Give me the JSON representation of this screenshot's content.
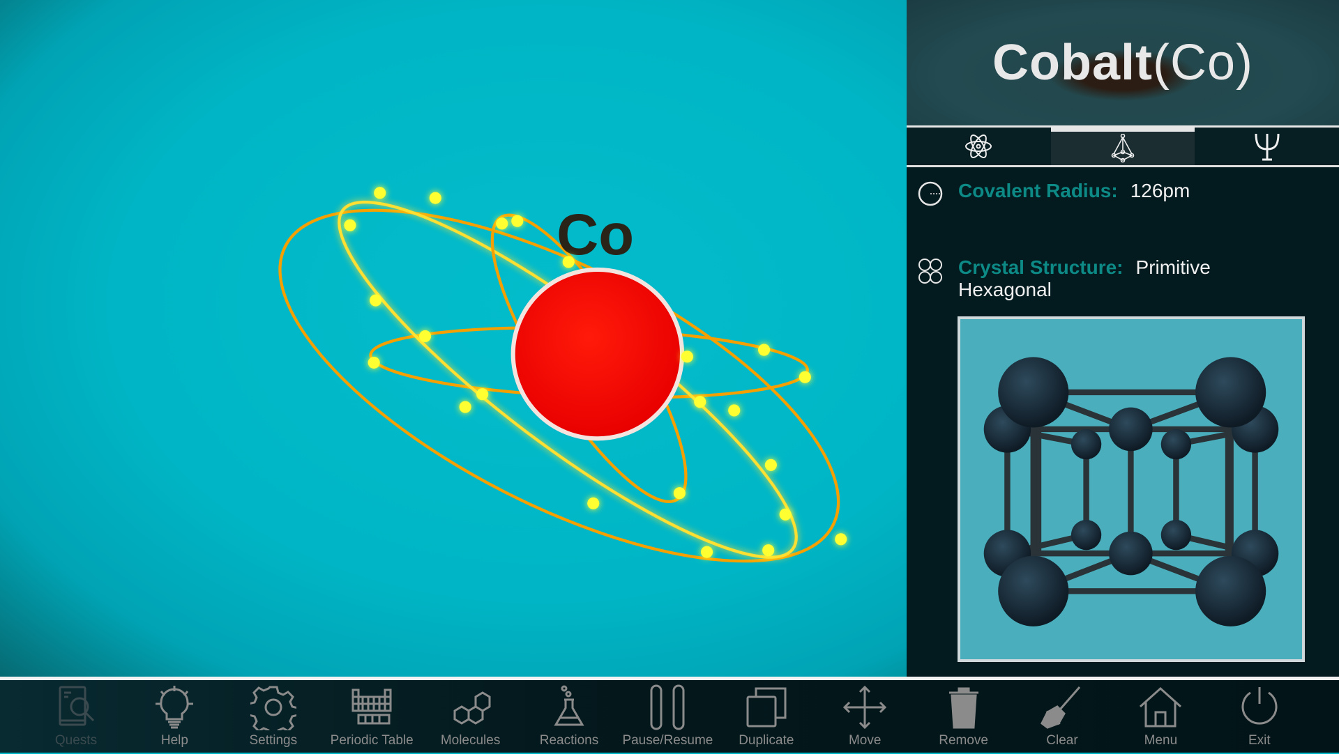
{
  "element": {
    "name": "Cobalt",
    "symbol": "Co",
    "title_symbol": "(Co)",
    "nucleus_color": "#ff0000",
    "orbit_color": "#f5a000",
    "electron_color": "#ffff20"
  },
  "panel": {
    "tabs": [
      {
        "icon": "atom-icon",
        "active": false
      },
      {
        "icon": "crystal-lattice-icon",
        "active": true
      },
      {
        "icon": "psi-icon",
        "active": false
      }
    ],
    "properties": [
      {
        "icon": "radius-circle-icon",
        "label": "Covalent Radius:",
        "value": "126pm"
      },
      {
        "icon": "crystal-structure-icon",
        "label": "Crystal Structure:",
        "value": "Primitive",
        "value_line2": "Hexagonal"
      }
    ]
  },
  "toolbar": {
    "items": [
      {
        "label": "Quests",
        "icon": "quests-book-search-icon",
        "enabled": false
      },
      {
        "label": "Help",
        "icon": "lightbulb-icon",
        "enabled": true
      },
      {
        "label": "Settings",
        "icon": "gear-icon",
        "enabled": true
      },
      {
        "label": "Periodic Table",
        "icon": "periodic-table-icon",
        "enabled": true
      },
      {
        "label": "Molecules",
        "icon": "molecule-icon",
        "enabled": true
      },
      {
        "label": "Reactions",
        "icon": "flask-icon",
        "enabled": true
      },
      {
        "label": "Pause/Resume",
        "icon": "pause-icon",
        "enabled": true
      },
      {
        "label": "Duplicate",
        "icon": "duplicate-icon",
        "enabled": true
      },
      {
        "label": "Move",
        "icon": "move-arrows-icon",
        "enabled": true
      },
      {
        "label": "Remove",
        "icon": "trash-icon",
        "enabled": true
      },
      {
        "label": "Clear",
        "icon": "broom-icon",
        "enabled": true
      },
      {
        "label": "Menu",
        "icon": "home-icon",
        "enabled": true
      },
      {
        "label": "Exit",
        "icon": "power-icon",
        "enabled": true
      }
    ]
  }
}
